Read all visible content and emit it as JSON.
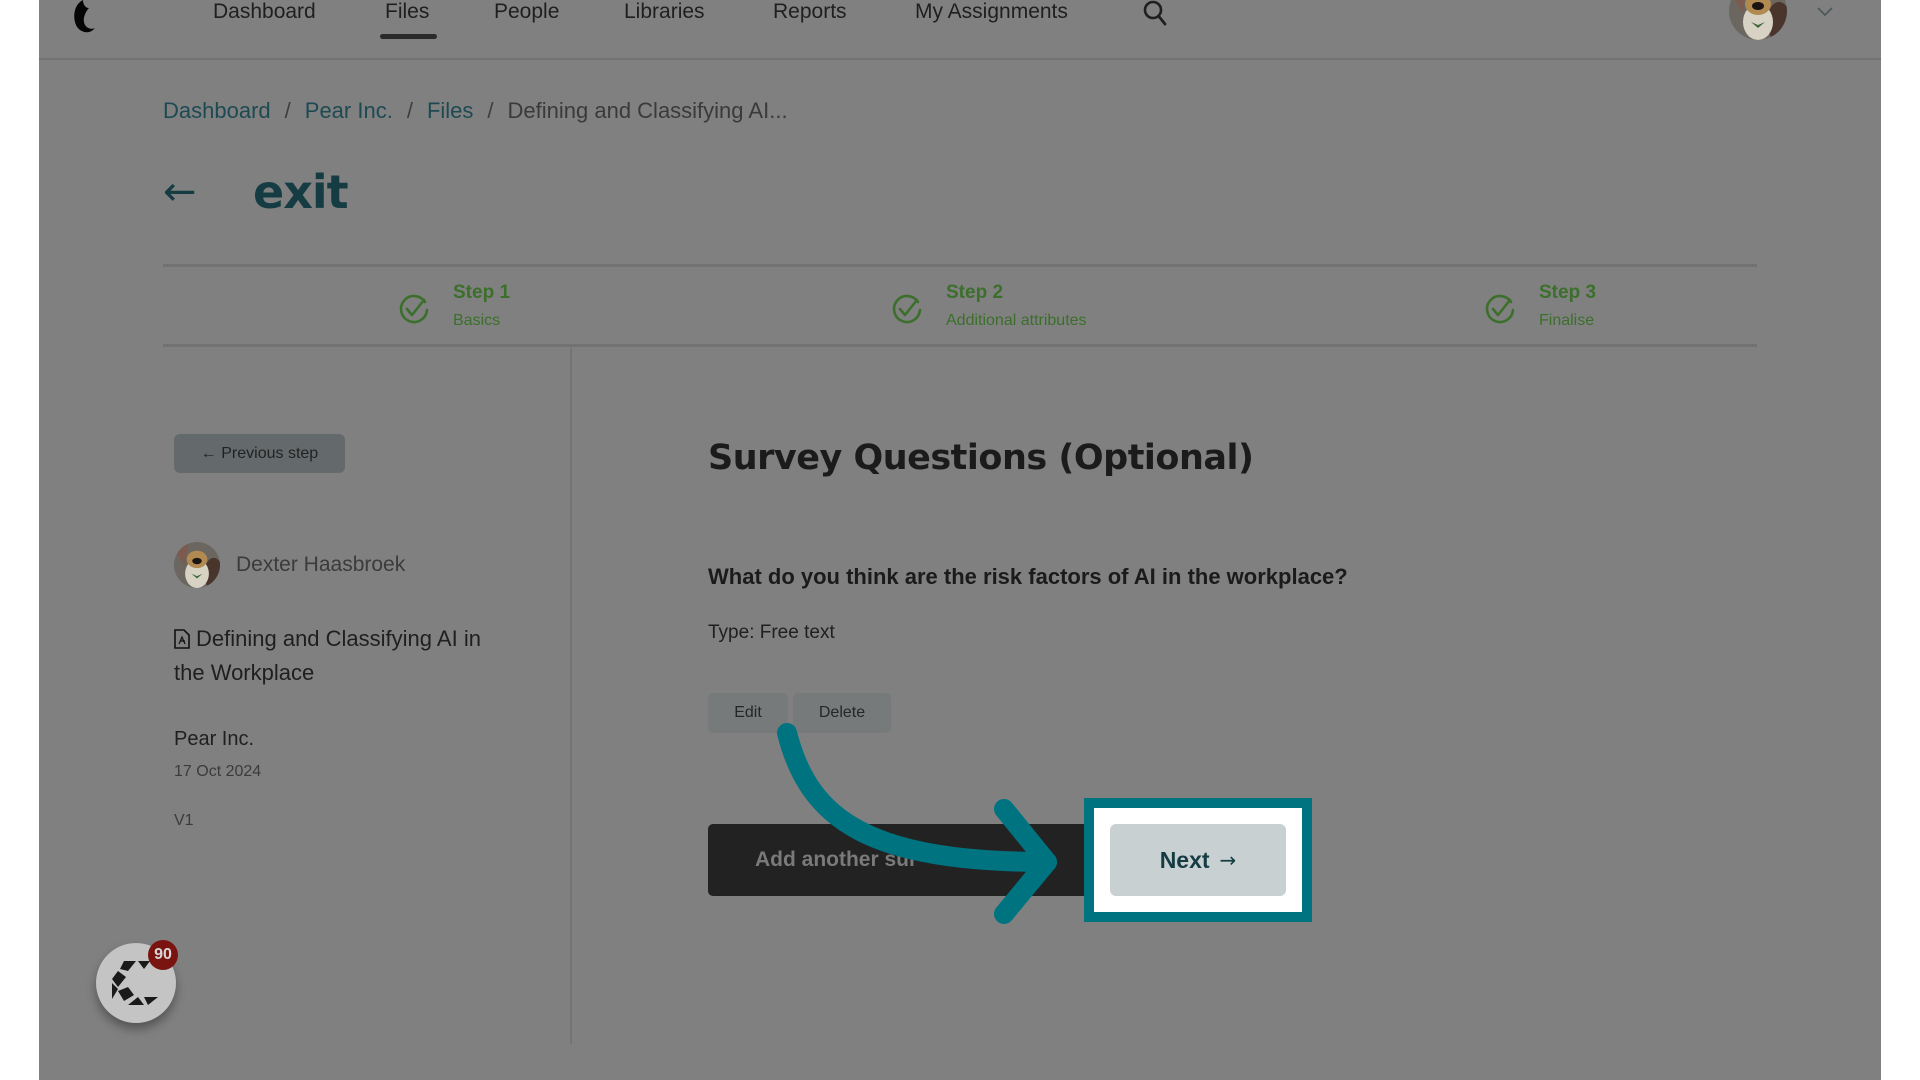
{
  "nav": {
    "items": [
      {
        "label": "Dashboard",
        "active": false
      },
      {
        "label": "Files",
        "active": true
      },
      {
        "label": "People",
        "active": false
      },
      {
        "label": "Libraries",
        "active": false
      },
      {
        "label": "Reports",
        "active": false
      },
      {
        "label": "My Assignments",
        "active": false
      }
    ],
    "search_icon": "search-icon",
    "user_menu_icon": "chevron-down-icon"
  },
  "breadcrumb": {
    "items": [
      "Dashboard",
      "Pear Inc.",
      "Files"
    ],
    "current": "Defining and Classifying AI...",
    "separator": "/"
  },
  "exit": {
    "arrow": "←",
    "label": "exit"
  },
  "stepper": {
    "steps": [
      {
        "title": "Step 1",
        "subtitle": "Basics",
        "status": "complete"
      },
      {
        "title": "Step 2",
        "subtitle": "Additional attributes",
        "status": "complete"
      },
      {
        "title": "Step 3",
        "subtitle": "Finalise",
        "status": "complete"
      }
    ],
    "complete_color": "#3b6f2b"
  },
  "sidebar": {
    "previous_step_label": "← Previous step",
    "author": "Dexter Haasbroek",
    "document_title": "Defining and Classifying AI in the Workplace",
    "organization": "Pear Inc.",
    "date": "17 Oct 2024",
    "version": "V1"
  },
  "main": {
    "section_title": "Survey Questions (Optional)",
    "question": "What do you think are the risk factors of AI in the workplace?",
    "question_type": "Type: Free text",
    "edit_label": "Edit",
    "delete_label": "Delete",
    "add_label": "Add another survey question",
    "add_label_visible": "Add another sur",
    "next_label": "Next",
    "next_arrow": "→"
  },
  "overlay": {
    "highlight_color": "#007380",
    "target": "next-button"
  },
  "widget": {
    "badge_count": "90"
  }
}
